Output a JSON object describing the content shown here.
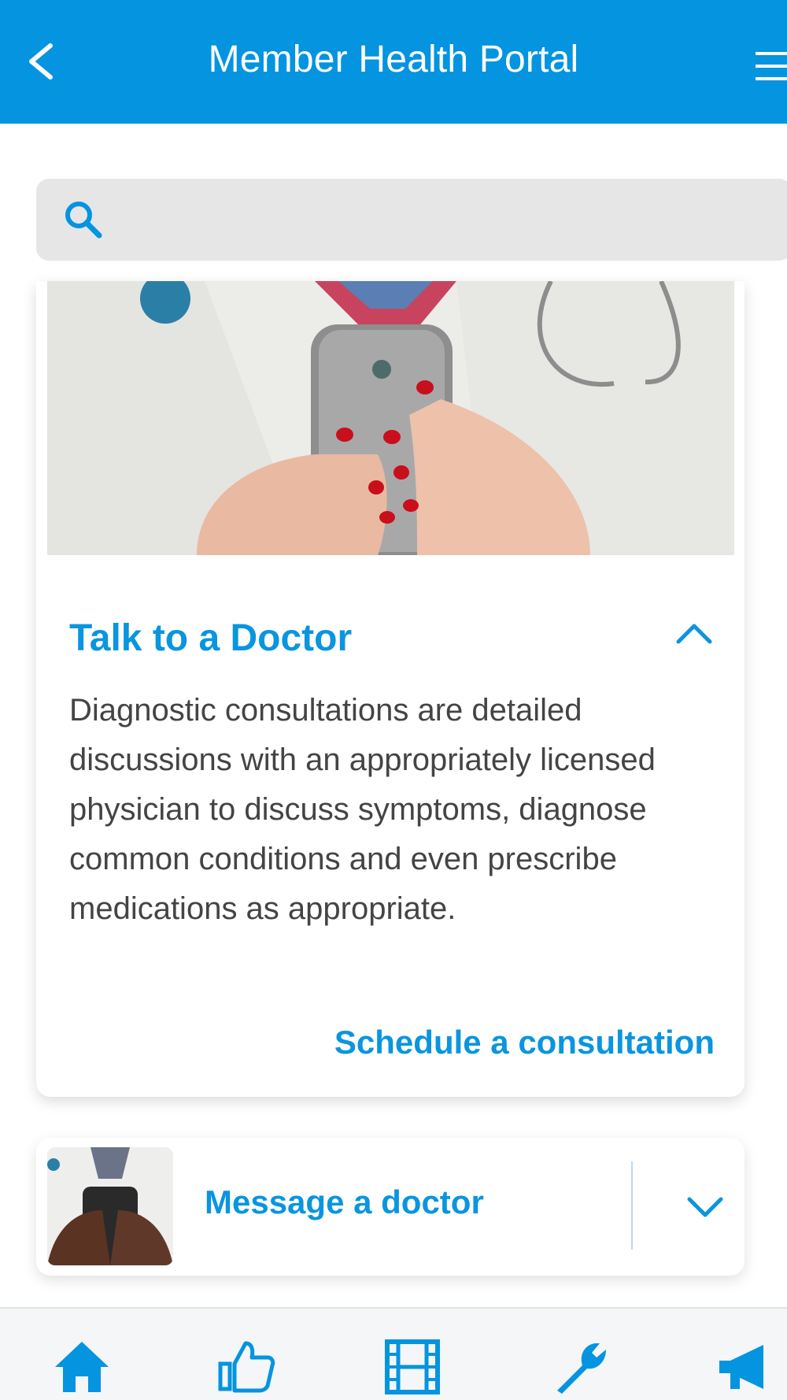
{
  "header": {
    "title": "Member Health Portal",
    "back_icon": "chevron-left-icon",
    "menu_icon": "hamburger-menu-icon"
  },
  "search": {
    "icon": "search-icon",
    "value": "",
    "placeholder": ""
  },
  "featured_card": {
    "image_alt": "Doctor holding a smartphone",
    "title": "Talk to a Doctor",
    "description": "Diagnostic consultations are detailed discussions with an appropriately licensed physician to discuss symptoms, diagnose common conditions and even prescribe medications as appropriate.",
    "action_label": "Schedule a consultation",
    "toggle_icon": "chevron-up-icon"
  },
  "list_item": {
    "label": "Message a doctor",
    "toggle_icon": "chevron-down-icon"
  },
  "tabbar": {
    "items": [
      {
        "icon": "home-icon"
      },
      {
        "icon": "thumbs-up-icon"
      },
      {
        "icon": "film-icon"
      },
      {
        "icon": "wrench-icon"
      },
      {
        "icon": "megaphone-icon"
      }
    ]
  },
  "colors": {
    "primary": "#0494e0",
    "link": "#0a95df",
    "text": "#444444",
    "search_bg": "#e6e6e6"
  }
}
